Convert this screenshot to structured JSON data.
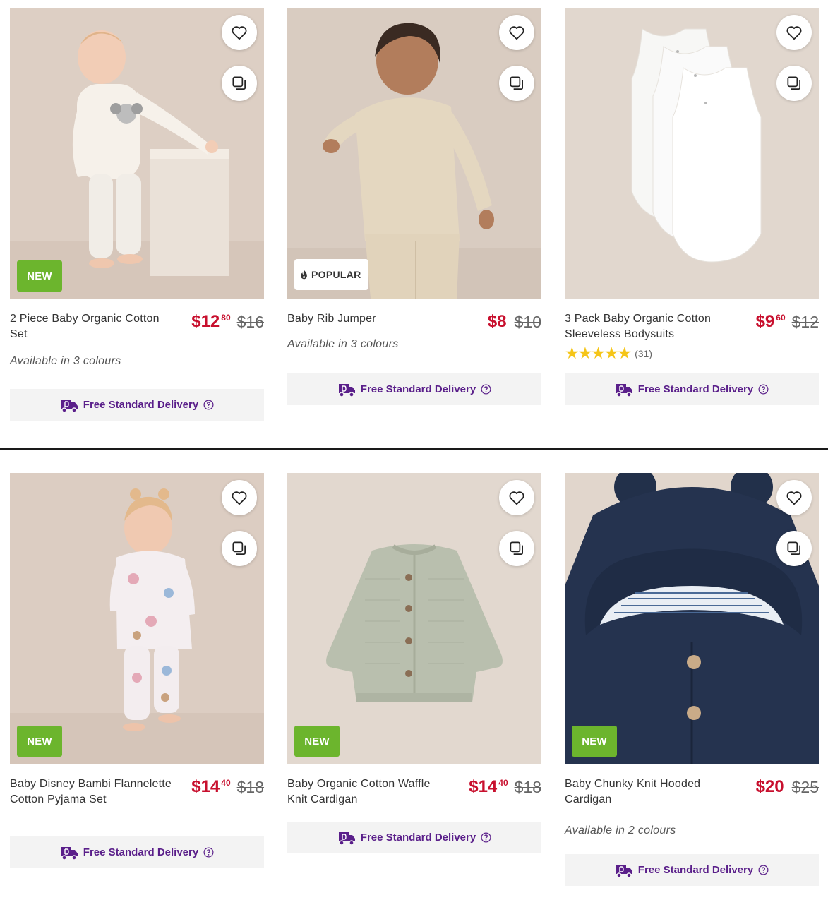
{
  "delivery_label": "Free Standard Delivery",
  "products": [
    {
      "title": "2 Piece Baby Organic Cotton Set",
      "price_dollars": "$12",
      "price_cents": "80",
      "was_price": "$16",
      "badge": "NEW",
      "availability": "Available in 3 colours"
    },
    {
      "title": "Baby Rib Jumper",
      "price_dollars": "$8",
      "price_cents": "",
      "was_price": "$10",
      "badge": "POPULAR",
      "availability": "Available in 3 colours"
    },
    {
      "title": "3 Pack Baby Organic Cotton Sleeveless Bodysuits",
      "price_dollars": "$9",
      "price_cents": "60",
      "was_price": "$12",
      "badge": "",
      "rating_stars": 5,
      "rating_count": "(31)"
    },
    {
      "title": "Baby Disney Bambi Flannelette Cotton Pyjama Set",
      "price_dollars": "$14",
      "price_cents": "40",
      "was_price": "$18",
      "badge": "NEW"
    },
    {
      "title": "Baby Organic Cotton Waffle Knit Cardigan",
      "price_dollars": "$14",
      "price_cents": "40",
      "was_price": "$18",
      "badge": "NEW"
    },
    {
      "title": "Baby Chunky Knit Hooded Cardigan",
      "price_dollars": "$20",
      "price_cents": "",
      "was_price": "$25",
      "badge": "NEW",
      "availability": "Available in 2 colours"
    }
  ],
  "colors": {
    "price_red": "#c8102e",
    "badge_green": "#6cb52d",
    "delivery_purple": "#5a1f8a",
    "star_yellow": "#f5c518"
  },
  "icons": {
    "wishlist": "heart-icon",
    "compare": "compare-icon",
    "delivery": "truck-icon",
    "help": "help-circle-icon",
    "popular": "flame-icon"
  }
}
